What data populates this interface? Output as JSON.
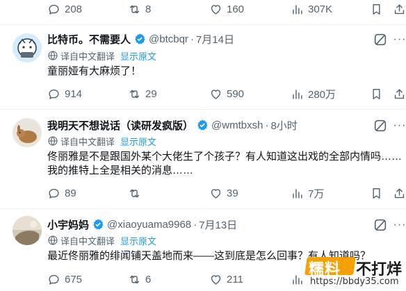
{
  "top_actions": {
    "replies": "208",
    "reposts": "8",
    "likes": "160",
    "views": "307K"
  },
  "tweets": [
    {
      "name": "比特币。不需要人",
      "handle": "@btcbqr",
      "time": "7月14日",
      "translated_label": "译自中文翻译",
      "show_original": "显示原文",
      "text": "童丽娅有大麻烦了！",
      "replies": "914",
      "reposts": "29",
      "likes": "590",
      "views": "280万"
    },
    {
      "name": "我明天不想说话（读研发疯版）",
      "handle": "@wmtbxsh",
      "time": "8小时",
      "translated_label": "译自中文翻译",
      "show_original": "显示原文",
      "text": "佟丽雅是不是跟国外某个大佬生了个孩子？有人知道这出戏的全部内情吗……我的推特上全是相关的消息……",
      "replies": "89",
      "reposts": "",
      "likes": "39",
      "views": "7万"
    },
    {
      "name": "小宇妈妈",
      "handle": "@xiaoyuama9968",
      "time": "7月13日",
      "translated_label": "译自中文翻译",
      "show_original": "显示原文",
      "text": "最近佟丽雅的绯闻铺天盖地而来——这到底是怎么回事？有人知道吗？",
      "replies": "675",
      "reposts": "6",
      "likes": "211",
      "views": ""
    }
  ],
  "separator": "·",
  "watermark": {
    "badge": "糯料",
    "text": "不打烊",
    "url": "https://bbdy35.com"
  },
  "colors": {
    "text": "#0f1419",
    "secondary": "#536471",
    "verified": "#1d9bf0",
    "link": "#1d9bf0",
    "divider": "#eff3f4",
    "watermark_badge": "#f5a100"
  }
}
